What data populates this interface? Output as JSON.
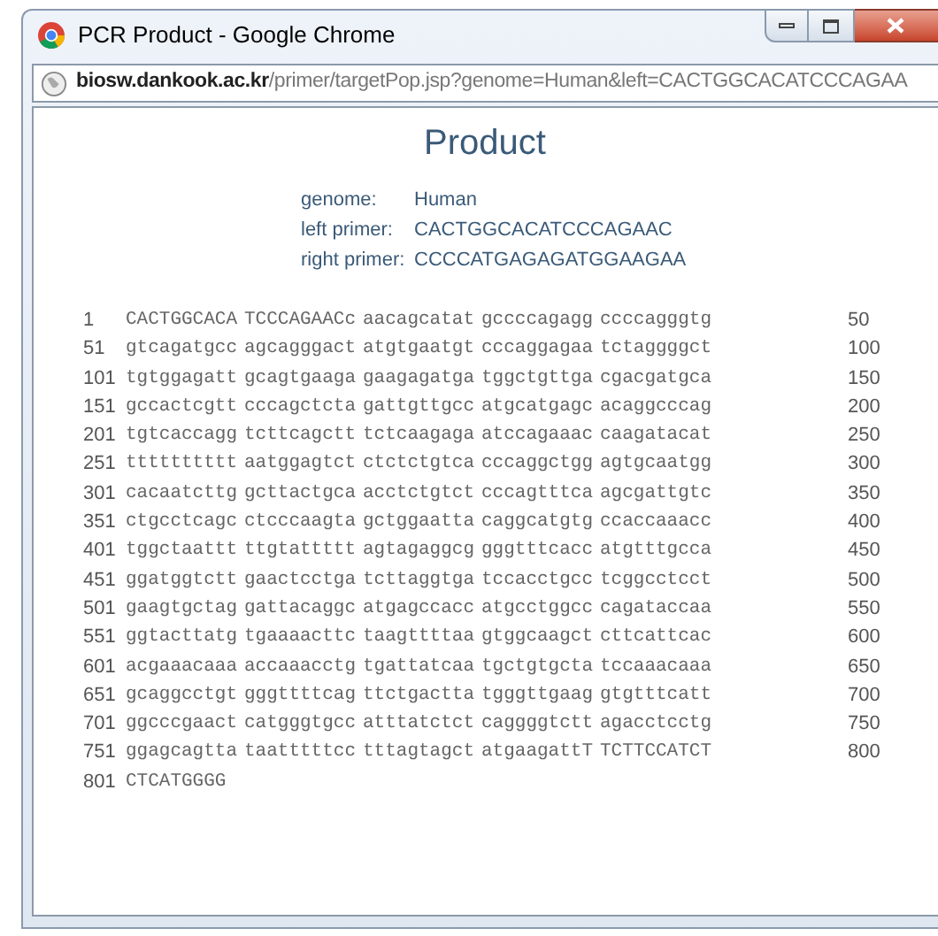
{
  "window": {
    "title": "PCR Product - Google Chrome"
  },
  "address_bar": {
    "host": "biosw.dankook.ac.kr",
    "path": "/primer/targetPop.jsp?genome=Human&left=CACTGGCACATCCCAGAA"
  },
  "heading": "Product",
  "fields": [
    {
      "label": "genome:",
      "value": "Human"
    },
    {
      "label": "left primer:",
      "value": "CACTGGCACATCCCAGAAC"
    },
    {
      "label": "right primer:",
      "value": "CCCCATGAGAGATGGAAGAA"
    }
  ],
  "sequence": [
    {
      "start": "1",
      "groups": [
        "CACTGGCACA",
        "TCCCAGAACc",
        "aacagcatat",
        "gccccagagg",
        "ccccagggtg"
      ],
      "end": "50"
    },
    {
      "start": "51",
      "groups": [
        "gtcagatgcc",
        "agcagggact",
        "atgtgaatgt",
        "cccaggagaa",
        "tctaggggct"
      ],
      "end": "100"
    },
    {
      "start": "101",
      "groups": [
        "tgtggagatt",
        "gcagtgaaga",
        "gaagagatga",
        "tggctgttga",
        "cgacgatgca"
      ],
      "end": "150"
    },
    {
      "start": "151",
      "groups": [
        "gccactcgtt",
        "cccagctcta",
        "gattgttgcc",
        "atgcatgagc",
        "acaggcccag"
      ],
      "end": "200"
    },
    {
      "start": "201",
      "groups": [
        "tgtcaccagg",
        "tcttcagctt",
        "tctcaagaga",
        "atccagaaac",
        "caagatacat"
      ],
      "end": "250"
    },
    {
      "start": "251",
      "groups": [
        "tttttttttt",
        "aatggagtct",
        "ctctctgtca",
        "cccaggctgg",
        "agtgcaatgg"
      ],
      "end": "300"
    },
    {
      "start": "301",
      "groups": [
        "cacaatcttg",
        "gcttactgca",
        "acctctgtct",
        "cccagtttca",
        "agcgattgtc"
      ],
      "end": "350"
    },
    {
      "start": "351",
      "groups": [
        "ctgcctcagc",
        "ctcccaagta",
        "gctggaatta",
        "caggcatgtg",
        "ccaccaaacc"
      ],
      "end": "400"
    },
    {
      "start": "401",
      "groups": [
        "tggctaattt",
        "ttgtattttt",
        "agtagaggcg",
        "gggtttcacc",
        "atgtttgcca"
      ],
      "end": "450"
    },
    {
      "start": "451",
      "groups": [
        "ggatggtctt",
        "gaactcctga",
        "tcttaggtga",
        "tccacctgcc",
        "tcggcctcct"
      ],
      "end": "500"
    },
    {
      "start": "501",
      "groups": [
        "gaagtgctag",
        "gattacaggc",
        "atgagccacc",
        "atgcctggcc",
        "cagataccaa"
      ],
      "end": "550"
    },
    {
      "start": "551",
      "groups": [
        "ggtacttatg",
        "tgaaaacttc",
        "taagttttaa",
        "gtggcaagct",
        "cttcattcac"
      ],
      "end": "600"
    },
    {
      "start": "601",
      "groups": [
        "acgaaacaaa",
        "accaaacctg",
        "tgattatcaa",
        "tgctgtgcta",
        "tccaaacaaa"
      ],
      "end": "650"
    },
    {
      "start": "651",
      "groups": [
        "gcaggcctgt",
        "gggttttcag",
        "ttctgactta",
        "tgggttgaag",
        "gtgtttcatt"
      ],
      "end": "700"
    },
    {
      "start": "701",
      "groups": [
        "ggcccgaact",
        "catgggtgcc",
        "atttatctct",
        "caggggtctt",
        "agacctcctg"
      ],
      "end": "750"
    },
    {
      "start": "751",
      "groups": [
        "ggagcagtta",
        "taatttttcc",
        "tttagtagct",
        "atgaagattT",
        "TCTTCCATCT"
      ],
      "end": "800"
    },
    {
      "start": "801",
      "groups": [
        "CTCATGGGG"
      ]
    }
  ]
}
